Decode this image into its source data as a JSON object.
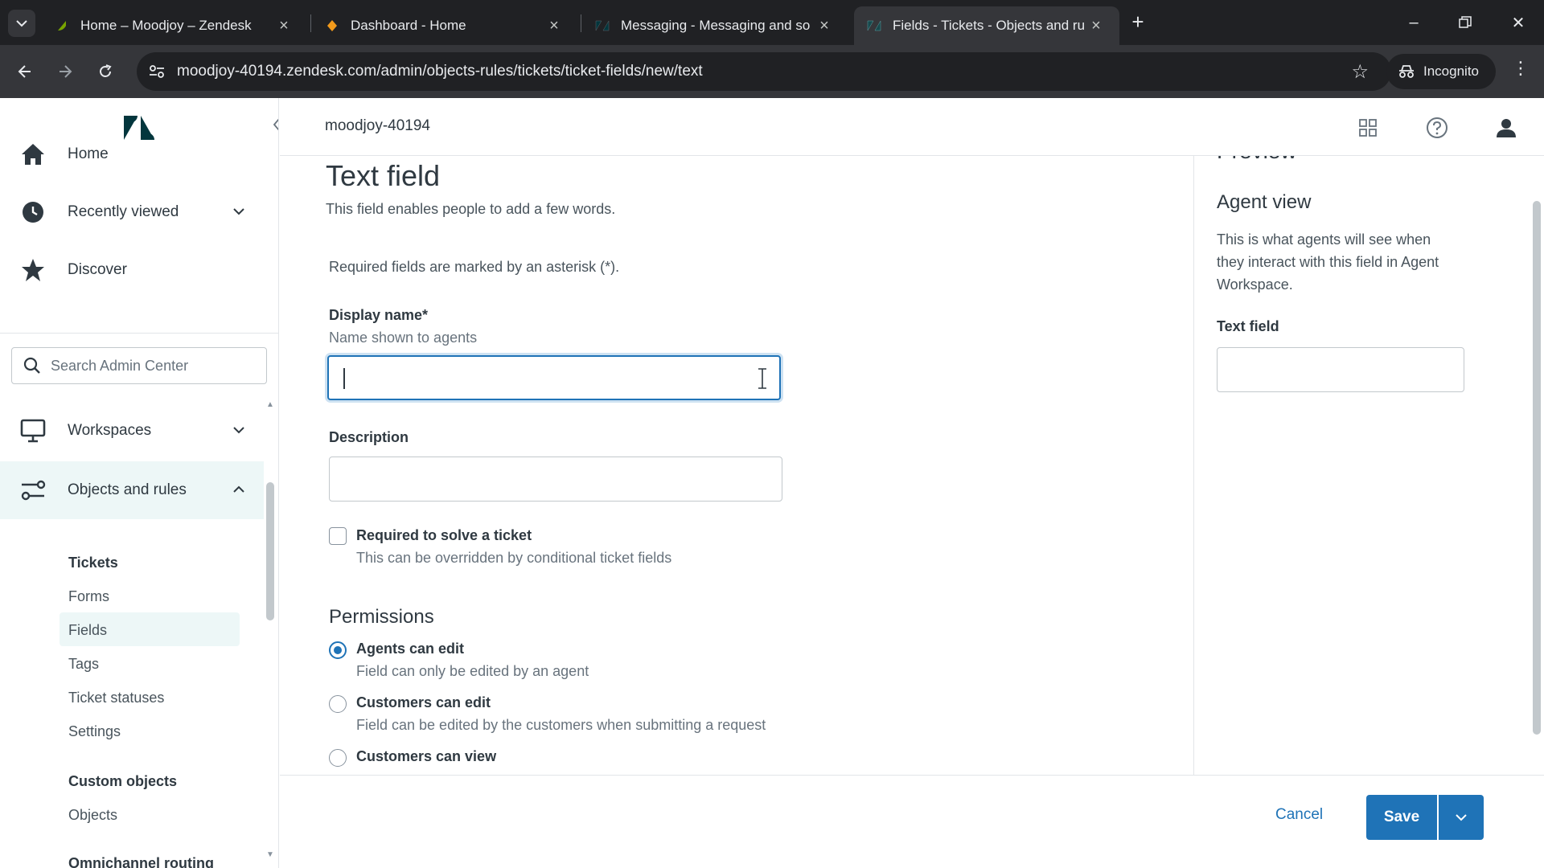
{
  "browser": {
    "tabs": [
      {
        "title": "Home – Moodjoy – Zendesk",
        "icon": "zendesk-leaf-icon"
      },
      {
        "title": "Dashboard - Home",
        "icon": "dashboard-icon"
      },
      {
        "title": "Messaging - Messaging and so",
        "icon": "zendesk-icon"
      },
      {
        "title": "Fields - Tickets - Objects and ru",
        "icon": "zendesk-icon",
        "active": true
      }
    ],
    "url": "moodjoy-40194.zendesk.com/admin/objects-rules/tickets/ticket-fields/new/text",
    "incognito_label": "Incognito"
  },
  "sidebar": {
    "nav": [
      {
        "label": "Home",
        "icon": "home-icon"
      },
      {
        "label": "Recently viewed",
        "icon": "clock-icon"
      },
      {
        "label": "Discover",
        "icon": "star-icon"
      }
    ],
    "search_placeholder": "Search Admin Center",
    "sections": [
      {
        "label": "Workspaces",
        "icon": "monitor-icon"
      },
      {
        "label": "Objects and rules",
        "icon": "objects-rules-icon"
      }
    ],
    "tickets_heading": "Tickets",
    "ticket_items": [
      "Forms",
      "Fields",
      "Tags",
      "Ticket statuses",
      "Settings"
    ],
    "custom_heading": "Custom objects",
    "custom_items": [
      "Objects"
    ],
    "cut_heading": "Omnichannel routing"
  },
  "topbar": {
    "account": "moodjoy-40194"
  },
  "form": {
    "title": "Text field",
    "subtitle": "This field enables people to add a few words.",
    "required_note": "Required fields are marked by an asterisk (*).",
    "display_name_label": "Display name*",
    "display_name_hint": "Name shown to agents",
    "display_name_value": "",
    "description_label": "Description",
    "description_value": "",
    "required_label": "Required to solve a ticket",
    "required_hint": "This can be overridden by conditional ticket fields",
    "permissions_title": "Permissions",
    "permissions": [
      {
        "label": "Agents can edit",
        "hint": "Field can only be edited by an agent",
        "selected": true
      },
      {
        "label": "Customers can edit",
        "hint": "Field can be edited by the customers when submitting a request",
        "selected": false
      },
      {
        "label": "Customers can view",
        "hint": "",
        "selected": false
      }
    ]
  },
  "preview": {
    "title": "Preview",
    "view_title": "Agent view",
    "view_text": "This is what agents will see when they interact with this field in Agent Workspace.",
    "field_label": "Text field"
  },
  "footer": {
    "cancel": "Cancel",
    "save": "Save"
  },
  "colors": {
    "accent": "#1f73b7",
    "active_bg": "#edf7f7",
    "brand_logo": "#03363d"
  }
}
